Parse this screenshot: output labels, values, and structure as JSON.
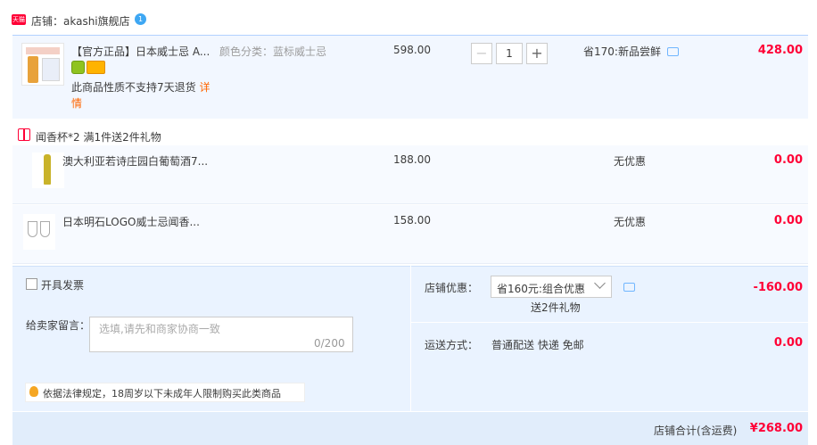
{
  "store": {
    "badge": "天猫",
    "name": "店铺：akashi旗舰店",
    "verify_badge": "1"
  },
  "main_item": {
    "title": "【官方正品】日本威士忌 A...",
    "sku": "颜色分类：蓝标威士忌",
    "notice_text": "此商品性质不支持7天退货",
    "notice_link": "详情",
    "unit_price": "598.00",
    "quantity": "1",
    "minus_label": "−",
    "plus_label": "+",
    "promo": "省170:新品尝鲜",
    "total": "428.00"
  },
  "gift": {
    "header": "闻香杯*2   满1件送2件礼物",
    "items": [
      {
        "title": "澳大利亚若诗庄园白葡萄酒7...",
        "price": "188.00",
        "promo": "无优惠",
        "total": "0.00"
      },
      {
        "title": "日本明石LOGO威士忌闻香...",
        "price": "158.00",
        "promo": "无优惠",
        "total": "0.00"
      }
    ]
  },
  "footer": {
    "invoice_label": "开具发票",
    "message_label": "给卖家留言：",
    "message_placeholder": "选填,请先和商家协商一致",
    "message_count": "0/200",
    "law_notice": "依据法律规定，18周岁以下未成年人限制购买此类商品",
    "shop_discount_label": "店铺优惠：",
    "shop_discount_value": "省160元:组合优惠",
    "shop_discount_sub": "送2件礼物",
    "shop_discount_amount": "-160.00",
    "shipping_label": "运送方式：",
    "shipping_value": "普通配送 快递 免邮",
    "shipping_amount": "0.00"
  },
  "summary": {
    "label": "店铺合计(含运费)",
    "amount": "¥268.00"
  },
  "colors": {
    "accent_red": "#ff0036",
    "row_bg": "#f2f7ff",
    "footer_bg": "#eaf3ff"
  }
}
